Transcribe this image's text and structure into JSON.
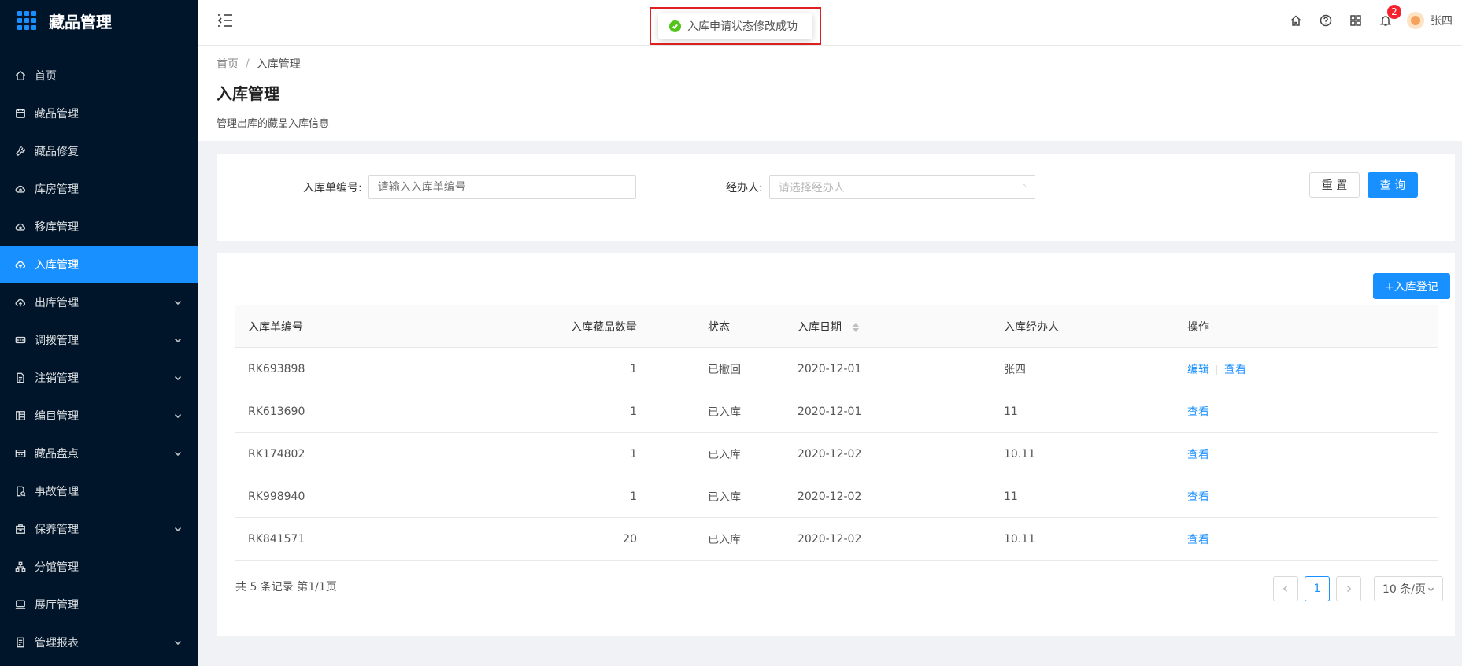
{
  "app": {
    "title": "藏品管理"
  },
  "sidebar": {
    "items": [
      {
        "label": "首页",
        "icon": "home-icon",
        "expandable": false,
        "active": false
      },
      {
        "label": "藏品管理",
        "icon": "calendar-icon",
        "expandable": false,
        "active": false
      },
      {
        "label": "藏品修复",
        "icon": "wrench-icon",
        "expandable": false,
        "active": false
      },
      {
        "label": "库房管理",
        "icon": "cloud-icon",
        "expandable": false,
        "active": false
      },
      {
        "label": "移库管理",
        "icon": "cloud-icon",
        "expandable": false,
        "active": false
      },
      {
        "label": "入库管理",
        "icon": "cloud-upload-icon",
        "expandable": false,
        "active": true
      },
      {
        "label": "出库管理",
        "icon": "cloud-upload-icon",
        "expandable": true,
        "active": false
      },
      {
        "label": "调拨管理",
        "icon": "transfer-icon",
        "expandable": true,
        "active": false
      },
      {
        "label": "注销管理",
        "icon": "file-icon",
        "expandable": true,
        "active": false
      },
      {
        "label": "编目管理",
        "icon": "catalog-icon",
        "expandable": true,
        "active": false
      },
      {
        "label": "藏品盘点",
        "icon": "inventory-icon",
        "expandable": true,
        "active": false
      },
      {
        "label": "事故管理",
        "icon": "incident-icon",
        "expandable": false,
        "active": false
      },
      {
        "label": "保养管理",
        "icon": "maintenance-icon",
        "expandable": true,
        "active": false
      },
      {
        "label": "分馆管理",
        "icon": "branch-icon",
        "expandable": false,
        "active": false
      },
      {
        "label": "展厅管理",
        "icon": "monitor-icon",
        "expandable": false,
        "active": false
      },
      {
        "label": "管理报表",
        "icon": "report-icon",
        "expandable": true,
        "active": false
      }
    ]
  },
  "header": {
    "notification_count": "2",
    "user_name": "张四"
  },
  "toast": {
    "message": "入库申请状态修改成功"
  },
  "page": {
    "breadcrumb": [
      "首页",
      "入库管理"
    ],
    "title": "入库管理",
    "description": "管理出库的藏品入库信息"
  },
  "search": {
    "order_no_label": "入库单编号:",
    "order_no_placeholder": "请输入入库单编号",
    "handler_label": "经办人:",
    "handler_placeholder": "请选择经办人",
    "reset_label": "重 置",
    "query_label": "查 询"
  },
  "table": {
    "add_label": "+入库登记",
    "columns": [
      "入库单编号",
      "入库藏品数量",
      "状态",
      "入库日期",
      "入库经办人",
      "操作"
    ],
    "rows": [
      {
        "no": "RK693898",
        "qty": "1",
        "status": "已撤回",
        "date": "2020-12-01",
        "handler": "张四",
        "actions": [
          "编辑",
          "查看"
        ]
      },
      {
        "no": "RK613690",
        "qty": "1",
        "status": "已入库",
        "date": "2020-12-01",
        "handler": "11",
        "actions": [
          "查看"
        ]
      },
      {
        "no": "RK174802",
        "qty": "1",
        "status": "已入库",
        "date": "2020-12-02",
        "handler": "10.11",
        "actions": [
          "查看"
        ]
      },
      {
        "no": "RK998940",
        "qty": "1",
        "status": "已入库",
        "date": "2020-12-02",
        "handler": "11",
        "actions": [
          "查看"
        ]
      },
      {
        "no": "RK841571",
        "qty": "20",
        "status": "已入库",
        "date": "2020-12-02",
        "handler": "10.11",
        "actions": [
          "查看"
        ]
      }
    ]
  },
  "pagination": {
    "summary": "共 5 条记录 第1/1页",
    "current_page": "1",
    "page_size": "10 条/页"
  },
  "colors": {
    "sidebar_bg": "#001529",
    "primary": "#1890ff",
    "badge": "#f5222d",
    "success": "#52c41a",
    "highlight_frame": "#e02020"
  }
}
